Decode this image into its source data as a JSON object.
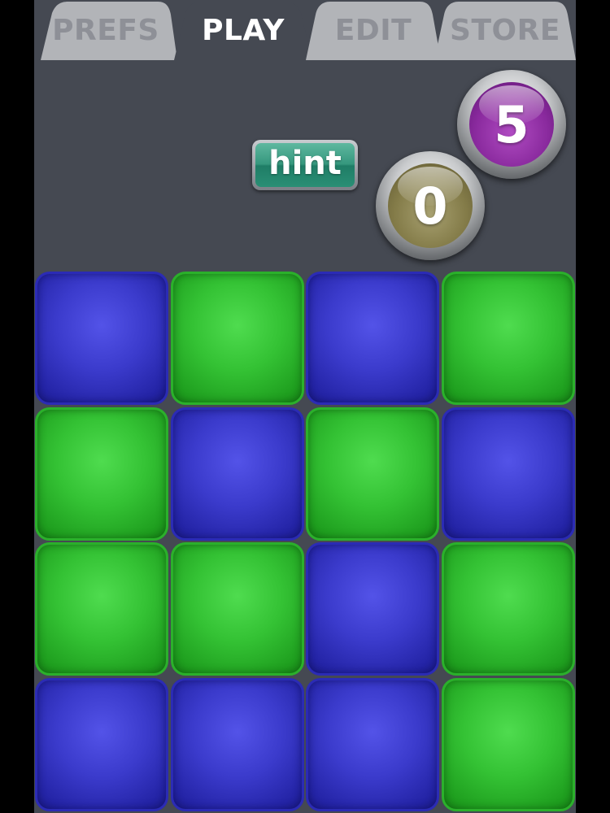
{
  "tabs": [
    {
      "label": "PREFS",
      "active": false
    },
    {
      "label": "PLAY",
      "active": true
    },
    {
      "label": "EDIT",
      "active": false
    },
    {
      "label": "STORE",
      "active": false
    }
  ],
  "hint_button": {
    "label": "hint"
  },
  "scores": {
    "purple_orb": "5",
    "olive_orb": "0"
  },
  "colors": {
    "background": "#454952",
    "tile_blue": "#3b3bcc",
    "tile_green": "#34c234",
    "hint_teal": "#35977d",
    "orb_purple": "#8a2a9e",
    "orb_olive": "#837b48"
  },
  "board": {
    "rows": 4,
    "cols": 4,
    "tiles": [
      [
        "blue",
        "green",
        "blue",
        "green"
      ],
      [
        "green",
        "blue",
        "green",
        "blue"
      ],
      [
        "green",
        "green",
        "blue",
        "green"
      ],
      [
        "blue",
        "blue",
        "blue",
        "green"
      ]
    ]
  }
}
